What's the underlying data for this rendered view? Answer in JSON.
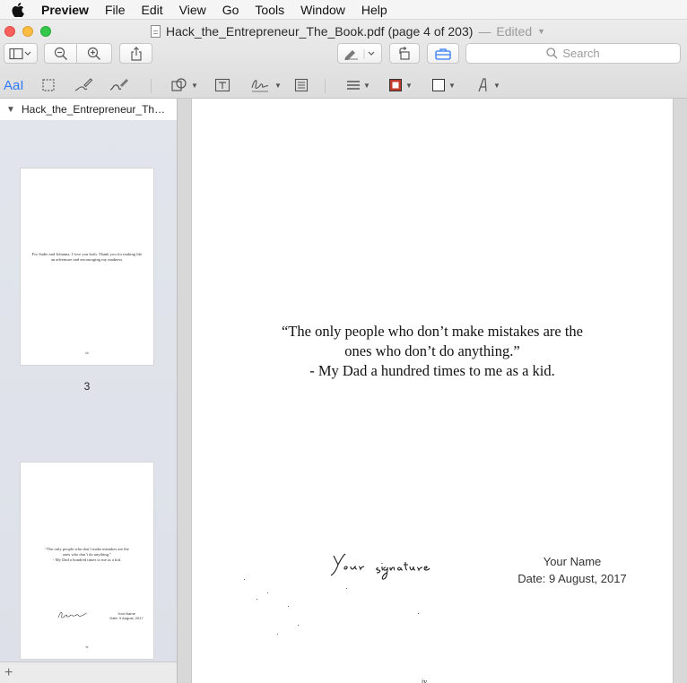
{
  "menubar": {
    "app_name": "Preview",
    "items": [
      "File",
      "Edit",
      "View",
      "Go",
      "Tools",
      "Window",
      "Help"
    ]
  },
  "window": {
    "title": "Hack_the_Entrepreneur_The_Book.pdf (page 4 of 203)",
    "separator": "—",
    "edited": "Edited"
  },
  "toolbar": {
    "search_placeholder": "Search",
    "icons": [
      "sidebar-icon",
      "zoom-out-icon",
      "zoom-in-icon",
      "share-icon",
      "highlight-pen-icon",
      "rotate-icon",
      "toolbox-icon"
    ]
  },
  "markup_toolbar": {
    "text_selection_label": "AaI",
    "accent_color": "#2f7bf5",
    "border_color": "#c0392b"
  },
  "sidebar": {
    "filename": "Hack_the_Entrepreneur_The_...",
    "thumbnails": [
      {
        "page_label": "3",
        "text": "For Sadie and Johanna, I love you both. Thank you for making life an adventure and encouraging my madness.",
        "page_number": "iii"
      },
      {
        "page_label": "",
        "quote_lines": [
          "“The only people who don’t make mistakes are the",
          "ones who don’t do anything.”",
          "- My Dad a hundred times to me as a kid."
        ],
        "name": "Your Name",
        "date": "Date: 9 August, 2017",
        "page_number": "iv"
      }
    ],
    "add_label": "+"
  },
  "page": {
    "quote_line1": "“The only people who don’t make mistakes are the",
    "quote_line2": "ones who don’t do anything.”",
    "quote_line3": "- My Dad a hundred times to me as a kid.",
    "signature_text": "Your signature",
    "name": "Your Name",
    "date": "Date: 9 August, 2017",
    "footer_mark": "iv"
  }
}
